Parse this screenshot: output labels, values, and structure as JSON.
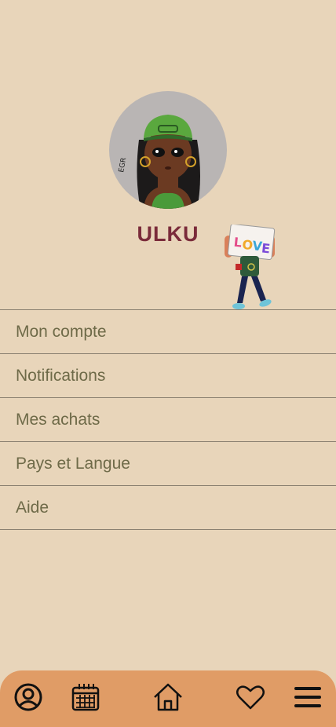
{
  "profile": {
    "username": "ULKU",
    "avatar_icon": "cartoon-avatar-girl-green-cap",
    "sticker_icon": "character-holding-love-sign",
    "sticker_text": "LOVE"
  },
  "menu": {
    "items": [
      {
        "label": "Mon compte"
      },
      {
        "label": "Notifications"
      },
      {
        "label": "Mes achats"
      },
      {
        "label": "Pays et Langue"
      },
      {
        "label": "Aide"
      }
    ]
  },
  "tabbar": {
    "background": "#e09c66",
    "icons": [
      "user-icon",
      "calendar-icon",
      "home-icon",
      "heart-icon",
      "menu-icon"
    ]
  },
  "colors": {
    "background": "#e8d5ba",
    "username": "#7a2b3a",
    "menu_text": "#6e6a48"
  }
}
